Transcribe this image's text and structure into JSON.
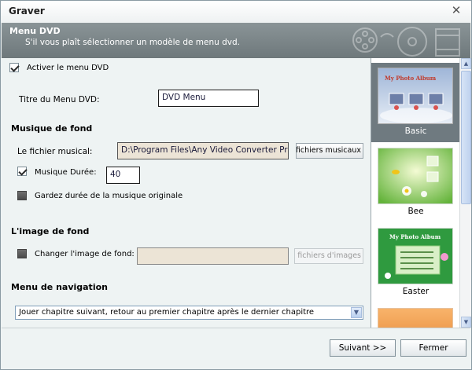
{
  "window": {
    "title": "Graver",
    "close_glyph": "✕"
  },
  "header": {
    "title": "Menu DVD",
    "subtitle": "S'il vous plaît sélectionner un modèle de menu dvd."
  },
  "options": {
    "enable_menu": {
      "label": "Activer le menu DVD",
      "checked": true
    },
    "menu_title": {
      "label": "Titre du Menu DVD:",
      "value": "DVD Menu"
    }
  },
  "music": {
    "section_title": "Musique de fond",
    "file_label": "Le fichier musical:",
    "file_value": "D:\\Program Files\\Any Video Converter Professional",
    "browse_label": "Ouvrir les fichiers musicaux",
    "duration": {
      "label": "Musique Durée:",
      "checked": true,
      "value": "40"
    },
    "keep_original": {
      "label": "Gardez durée de la musique originale",
      "checked": false
    }
  },
  "background": {
    "section_title": "L'image de fond",
    "change": {
      "label": "Changer l'image de fond:",
      "checked": false
    },
    "file_value": "",
    "browse_label": "Ouvrir les fichiers d'images"
  },
  "navigation": {
    "section_title": "Menu de navigation",
    "selected": "Jouer chapitre suivant, retour au premier chapitre après le dernier chapitre"
  },
  "templates": [
    {
      "name": "Basic",
      "thumb_text": "My Photo Album",
      "selected": true
    },
    {
      "name": "Bee",
      "selected": false
    },
    {
      "name": "Easter",
      "thumb_text": "My Photo Album",
      "selected": false
    }
  ],
  "footer": {
    "next_label": "Suivant >>",
    "close_label": "Fermer"
  },
  "colors": {
    "header_bg": "#7a8386",
    "selected_template_bg": "#6f7a80",
    "window_bg": "#eef3f3"
  }
}
